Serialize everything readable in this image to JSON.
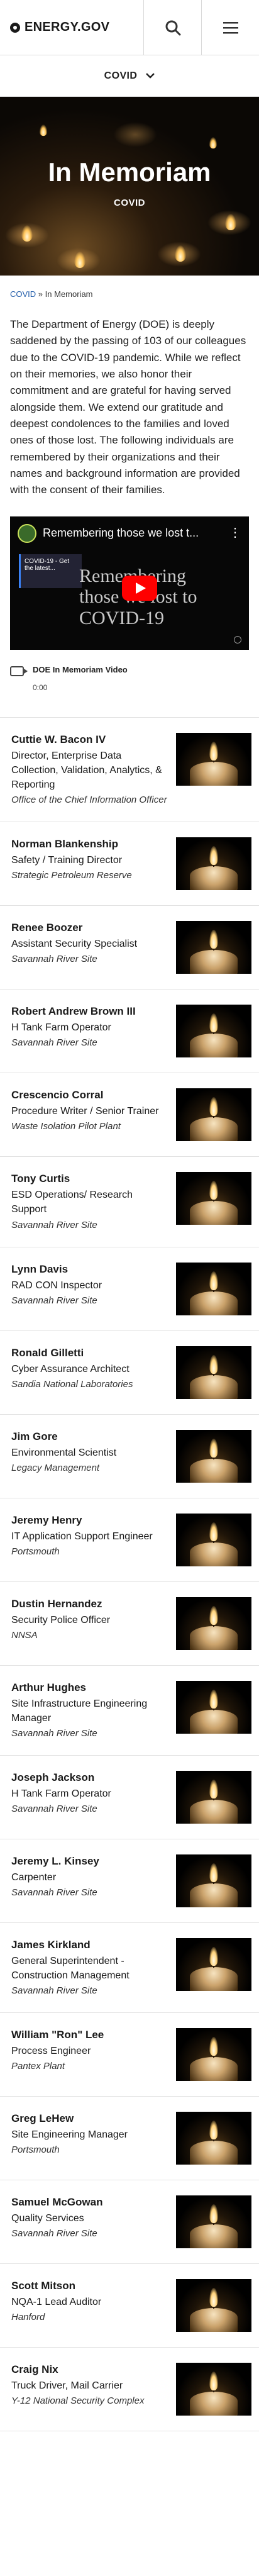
{
  "header": {
    "logo_text": "ENERGY.GOV"
  },
  "section_nav": {
    "label": "COVID"
  },
  "hero": {
    "title": "In Memoriam",
    "subtitle": "COVID"
  },
  "breadcrumb": {
    "parent": "COVID",
    "separator": "»",
    "current": "In Memoriam"
  },
  "intro": "The Department of Energy (DOE) is deeply saddened by the passing of 103 of our colleagues due to the COVID-19 pandemic. While we reflect on their memories, we also honor their commitment and are grateful for having served alongside them. We extend our gratitude and deepest condolences to the families and loved ones of those lost. The following individuals are remembered by their organizations and their names and background information are provided with the consent of their families.",
  "video": {
    "title": "Remembering those we lost t...",
    "card_text": "COVID-19 - Get the latest...",
    "overlay_text": "Remembering those we lost to COVID-19",
    "caption": "DOE In Memoriam Video",
    "length": "0:00"
  },
  "people": [
    {
      "name": "Cuttie W. Bacon IV",
      "title": "Director, Enterprise Data Collection, Validation, Analytics, & Reporting",
      "org": "Office of the Chief Information Officer"
    },
    {
      "name": "Norman Blankenship",
      "title": "Safety / Training Director",
      "org": "Strategic Petroleum Reserve"
    },
    {
      "name": "Renee Boozer",
      "title": "Assistant Security Specialist",
      "org": "Savannah River Site"
    },
    {
      "name": "Robert Andrew Brown III",
      "title": "H Tank Farm Operator",
      "org": "Savannah River Site"
    },
    {
      "name": "Crescencio Corral",
      "title": "Procedure Writer / Senior Trainer",
      "org": "Waste Isolation Pilot Plant"
    },
    {
      "name": "Tony Curtis",
      "title": "ESD Operations/ Research Support",
      "org": "Savannah River Site"
    },
    {
      "name": "Lynn Davis",
      "title": "RAD CON Inspector",
      "org": "Savannah River Site"
    },
    {
      "name": "Ronald Gilletti",
      "title": "Cyber Assurance Architect",
      "org": "Sandia National Laboratories"
    },
    {
      "name": "Jim Gore",
      "title": "Environmental Scientist",
      "org": "Legacy Management"
    },
    {
      "name": "Jeremy Henry",
      "title": "IT Application Support Engineer",
      "org": "Portsmouth"
    },
    {
      "name": "Dustin Hernandez",
      "title": "Security Police Officer",
      "org": "NNSA"
    },
    {
      "name": "Arthur Hughes",
      "title": "Site Infrastructure Engineering Manager",
      "org": "Savannah River Site"
    },
    {
      "name": "Joseph Jackson",
      "title": "H Tank Farm Operator",
      "org": "Savannah River Site"
    },
    {
      "name": "Jeremy L. Kinsey",
      "title": "Carpenter",
      "org": "Savannah River Site"
    },
    {
      "name": "James Kirkland",
      "title": "General Superintendent - Construction Management",
      "org": "Savannah River Site"
    },
    {
      "name": "William \"Ron\" Lee",
      "title": "Process Engineer",
      "org": "Pantex Plant"
    },
    {
      "name": "Greg LeHew",
      "title": "Site Engineering Manager",
      "org": "Portsmouth"
    },
    {
      "name": "Samuel McGowan",
      "title": "Quality Services",
      "org": "Savannah River Site"
    },
    {
      "name": "Scott Mitson",
      "title": "NQA-1 Lead Auditor",
      "org": "Hanford"
    },
    {
      "name": "Craig Nix",
      "title": "Truck Driver, Mail Carrier",
      "org": "Y-12 National Security Complex"
    }
  ]
}
